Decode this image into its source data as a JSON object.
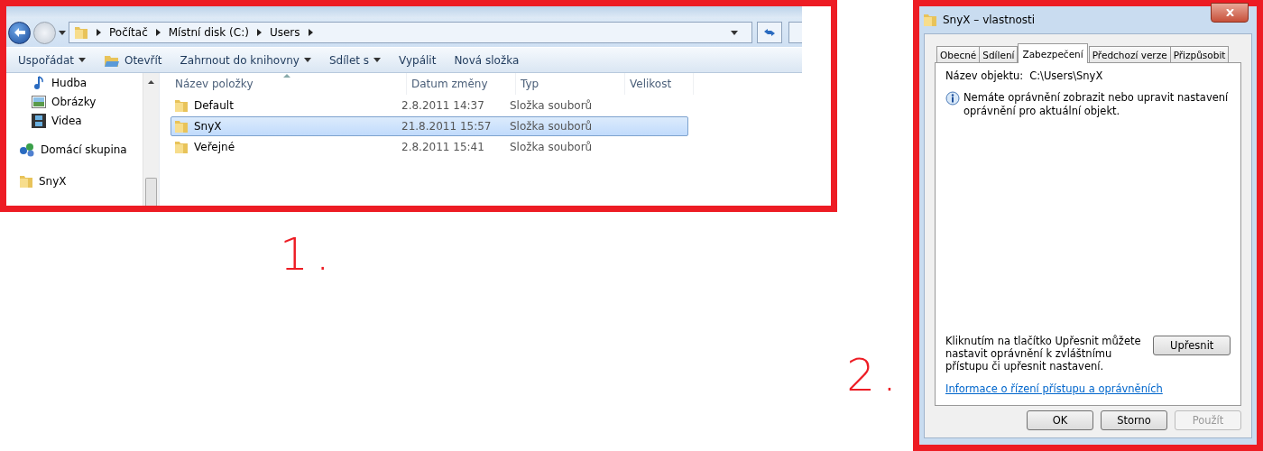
{
  "explorer": {
    "breadcrumb": [
      "Počítač",
      "Místní disk (C:)",
      "Users"
    ],
    "toolbar": [
      {
        "label": "Uspořádat",
        "kind": "dropdown"
      },
      {
        "label": "Otevřít",
        "kind": "icon"
      },
      {
        "label": "Zahrnout do knihovny",
        "kind": "dropdown"
      },
      {
        "label": "Sdílet s",
        "kind": "dropdown"
      },
      {
        "label": "Vypálit",
        "kind": "plain"
      },
      {
        "label": "Nová složka",
        "kind": "plain"
      }
    ],
    "nav": [
      {
        "label": "Hudba",
        "kind": "music"
      },
      {
        "label": "Obrázky",
        "kind": "pictures"
      },
      {
        "label": "Videa",
        "kind": "videos"
      },
      {
        "label": "Domácí skupina",
        "kind": "homegroup"
      },
      {
        "label": "SnyX",
        "kind": "user"
      }
    ],
    "columns": [
      "Název položky",
      "Datum změny",
      "Typ",
      "Velikost"
    ],
    "rows": [
      {
        "name": "Default",
        "modified": "2.8.2011 14:37",
        "type": "Složka souborů",
        "selected": false
      },
      {
        "name": "SnyX",
        "modified": "21.8.2011 15:57",
        "type": "Složka souborů",
        "selected": true
      },
      {
        "name": "Veřejné",
        "modified": "2.8.2011 15:41",
        "type": "Složka souborů",
        "selected": false
      }
    ]
  },
  "dialog": {
    "title": "SnyX – vlastnosti",
    "tabs": [
      {
        "label": "Obecné",
        "selected": false
      },
      {
        "label": "Sdílení",
        "selected": false
      },
      {
        "label": "Zabezpečení",
        "selected": true
      },
      {
        "label": "Předchozí verze",
        "selected": false
      },
      {
        "label": "Přizpůsobit",
        "selected": false
      }
    ],
    "object_label": "Název objektu:",
    "object_value": "C:\\Users\\SnyX",
    "info": "Nemáte oprávnění zobrazit nebo upravit nastavení oprávnění pro aktuální objekt.",
    "advanced_text": "Kliknutím na tlačítko Upřesnit můžete nastavit oprávnění k zvláštnímu přístupu či upřesnit nastavení.",
    "advanced_button": "Upřesnit",
    "link": "Informace o řízení přístupu a oprávněních",
    "buttons": [
      {
        "label": "OK",
        "disabled": false
      },
      {
        "label": "Storno",
        "disabled": false
      },
      {
        "label": "Použít",
        "disabled": true
      }
    ]
  },
  "annotations": [
    "1.",
    "2."
  ]
}
